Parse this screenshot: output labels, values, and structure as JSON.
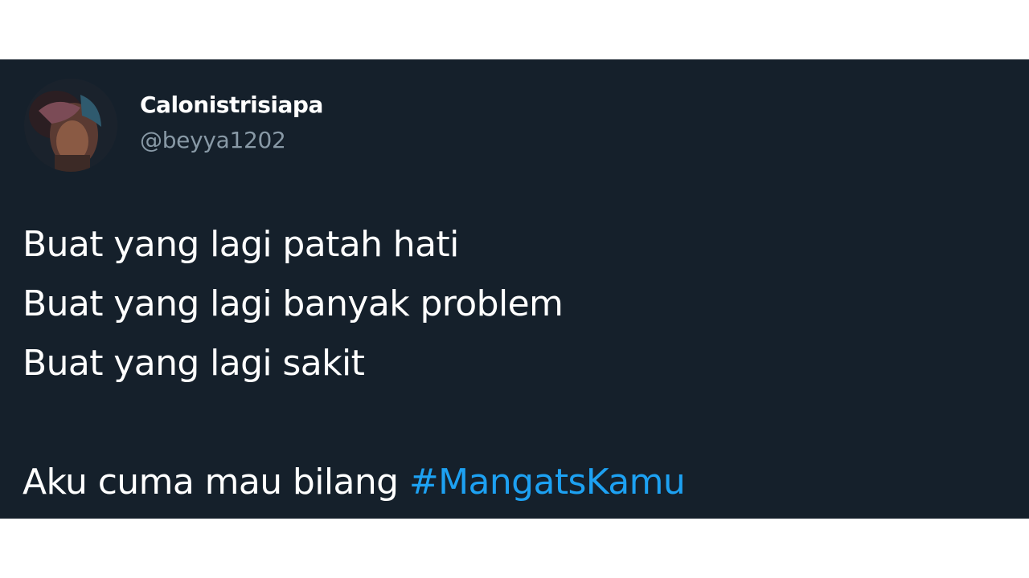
{
  "tweet": {
    "author": {
      "display_name": "Calonistrisiapa",
      "handle": "@beyya1202"
    },
    "lines": [
      "Buat yang lagi patah hati",
      "Buat yang lagi banyak problem",
      "Buat yang lagi sakit"
    ],
    "final_line_text": "Aku cuma mau bilang ",
    "hashtag": "#MangatsKamu",
    "colors": {
      "card_background": "#15202b",
      "text": "#ffffff",
      "handle": "#8899a6",
      "hashtag": "#1da1f2",
      "page_background": "#ffffff"
    }
  }
}
